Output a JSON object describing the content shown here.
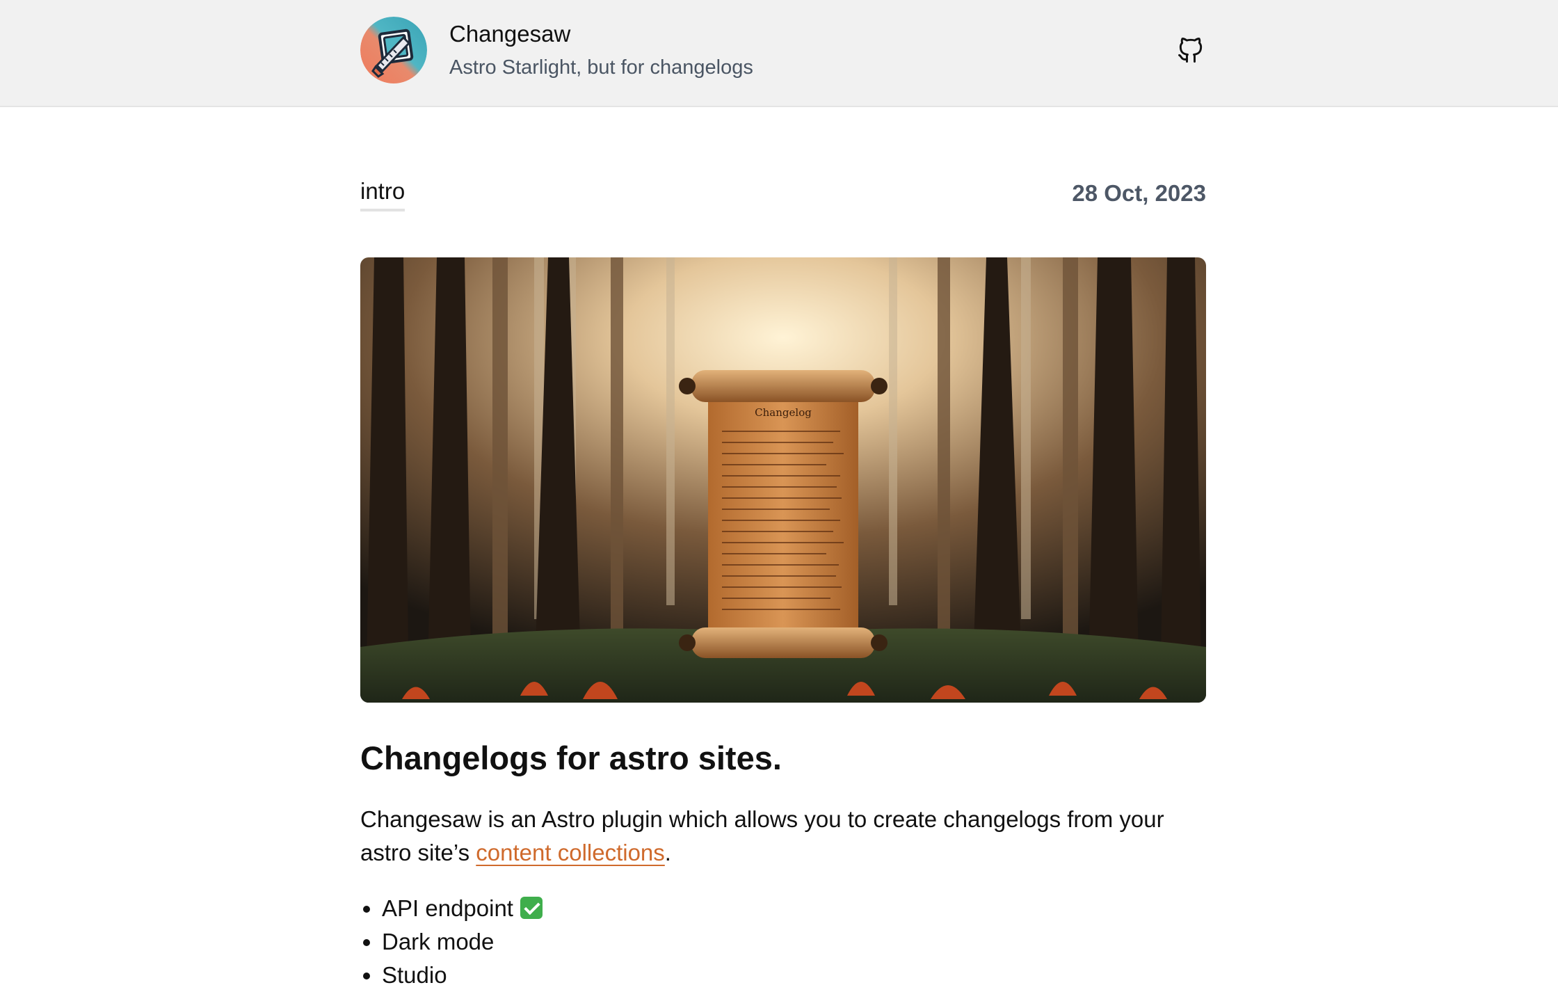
{
  "header": {
    "title": "Changesaw",
    "tagline": "Astro Starlight, but for changelogs",
    "logo_icon": "saw-icon",
    "github_icon": "github-icon"
  },
  "post": {
    "tag": "intro",
    "date": "28 Oct, 2023",
    "hero_image": {
      "scroll_heading": "Changelog"
    },
    "title": "Changelogs for astro sites.",
    "intro_before_link": "Changesaw is an Astro plugin which allows you to create changelogs from your astro site’s ",
    "intro_link": "content collections",
    "intro_after_link": ".",
    "features": [
      "API endpoint",
      "Dark mode",
      "Studio"
    ]
  },
  "colors": {
    "link": "#cf6a2c",
    "header_bg": "#f1f1f1",
    "muted_text": "#4a5563"
  }
}
